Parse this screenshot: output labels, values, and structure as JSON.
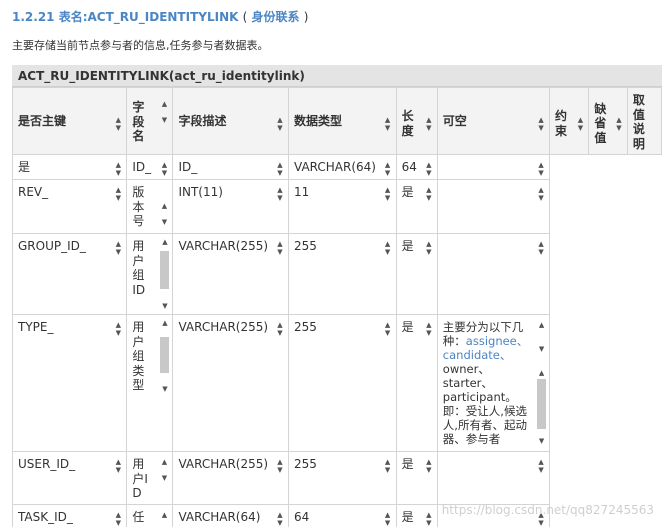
{
  "heading": {
    "number": "1.2.21",
    "title": "表名:ACT_RU_IDENTITYLINK",
    "paren_open": "(",
    "link": "身份联系",
    "paren_close": ")"
  },
  "intro": "主要存储当前节点参与者的信息,任务参与者数据表。",
  "table": {
    "caption": "ACT_RU_IDENTITYLINK(act_ru_identitylink)",
    "headers": [
      "是否主键",
      "字段名",
      "字段描述",
      "数据类型",
      "长度",
      "可空",
      "约束",
      "缺省值",
      "取值说明"
    ],
    "rows": [
      {
        "pk": "是",
        "name": "ID_",
        "desc": "ID_",
        "type": "VARCHAR(64)",
        "length": "64",
        "nullable": ""
      },
      {
        "pk": "REV_",
        "name": "版本号",
        "desc": "INT(11)",
        "type": "11",
        "length": "是",
        "nullable": ""
      },
      {
        "pk": "GROUP_ID_",
        "name": "用户组ID",
        "desc": "VARCHAR(255)",
        "type": "255",
        "length": "是",
        "nullable": ""
      },
      {
        "pk": "TYPE_",
        "name": "用户组类型",
        "desc": "VARCHAR(255)",
        "type": "255",
        "length": "是",
        "nullable_parts": [
          "主要分为以下几种：",
          "assignee、candidate、",
          "owner、starter、participant。即：受让人,候选人,所有者、起动器、参与者"
        ]
      },
      {
        "pk": "USER_ID_",
        "name": "用户ID",
        "desc": "VARCHAR(255)",
        "type": "255",
        "length": "是",
        "nullable": ""
      },
      {
        "pk": "TASK_ID_",
        "name": "任",
        "desc": "VARCHAR(64)",
        "type": "64",
        "length": "是",
        "nullable": ""
      }
    ]
  },
  "watermark": "https://blog.csdn.net/qq827245563"
}
